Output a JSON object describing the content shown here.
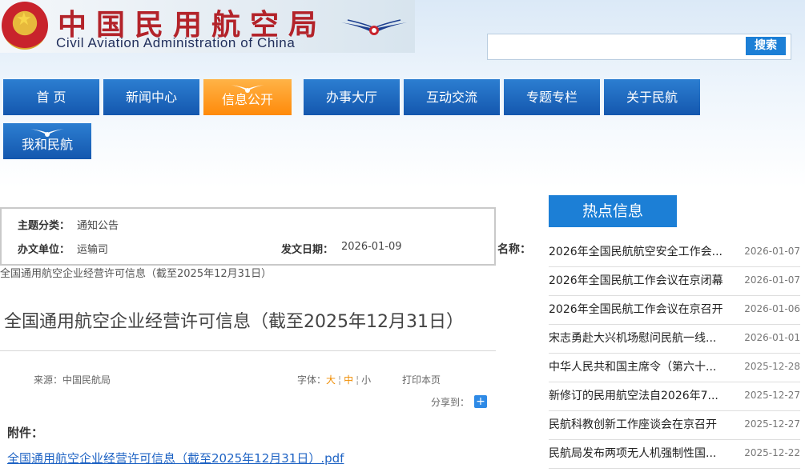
{
  "header": {
    "cn_title": "中国民用航空局",
    "en_title": "Civil Aviation Administration of China",
    "emblem": "national-emblem-icon",
    "logo": "caac-wings-logo"
  },
  "search": {
    "placeholder": "",
    "value": "",
    "button_label": "搜索"
  },
  "nav": {
    "items": [
      {
        "label": "首 页"
      },
      {
        "label": "新闻中心"
      },
      {
        "label": "信息公开",
        "active": true
      },
      {
        "label": "办事大厅"
      },
      {
        "label": "互动交流"
      },
      {
        "label": "专题专栏"
      },
      {
        "label": "关于民航"
      },
      {
        "label": "我和民航"
      }
    ],
    "active_color": "#ff8a0a",
    "color": "#1457ae"
  },
  "info": {
    "topic_label": "主题分类：",
    "topic_value": "通知公告",
    "unit_label": "办文单位：",
    "unit_value": "运输司",
    "date_label": "发文日期：",
    "date_value": "2026-01-09",
    "name_label": "名称："
  },
  "article": {
    "small_title": "全国通用航空企业经营许可信息（截至2025年12月31日）",
    "title": "全国通用航空企业经营许可信息（截至2025年12月31日）",
    "source": "来源：中国民航局",
    "font_label": "字体：",
    "font_large": "大",
    "font_medium": "中",
    "font_small": "小",
    "print_label": "打印本页",
    "share_label": "分享到：",
    "attachment_label": "附件：",
    "attachment_link": "全国通用航空企业经营许可信息（截至2025年12月31日）.pdf"
  },
  "hot": {
    "header": "热点信息",
    "items": [
      {
        "title": "2026年全国民航航空安全工作会...",
        "date": "2026-01-07"
      },
      {
        "title": "2026年全国民航工作会议在京闭幕",
        "date": "2026-01-07"
      },
      {
        "title": "2026年全国民航工作会议在京召开",
        "date": "2026-01-06"
      },
      {
        "title": "宋志勇赴大兴机场慰问民航一线...",
        "date": "2026-01-01"
      },
      {
        "title": "中华人民共和国主席令（第六十...",
        "date": "2025-12-28"
      },
      {
        "title": "新修订的民用航空法自2026年7...",
        "date": "2025-12-27"
      },
      {
        "title": "民航科教创新工作座谈会在京召开",
        "date": "2025-12-27"
      },
      {
        "title": "民航局发布两项无人机强制性国...",
        "date": "2025-12-22"
      }
    ]
  }
}
